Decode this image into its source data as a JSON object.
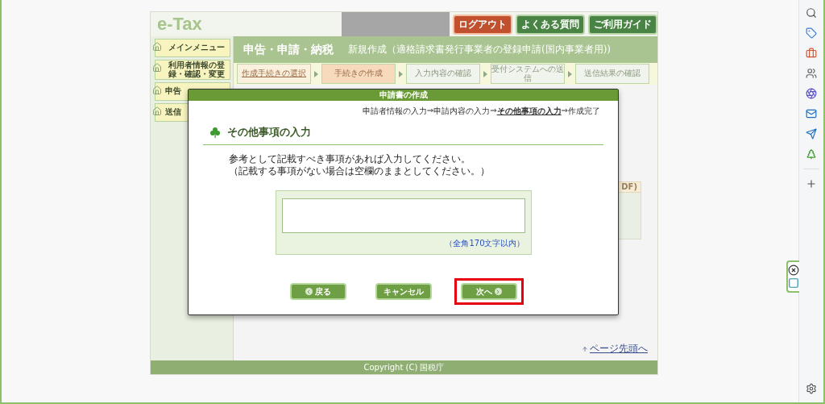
{
  "header": {
    "logo": "e-Tax",
    "buttons": [
      {
        "label": "ログアウト",
        "kind": "logout"
      },
      {
        "label": "よくある質問",
        "kind": "nav"
      },
      {
        "label": "ご利用ガイド",
        "kind": "nav"
      }
    ]
  },
  "sidebar": {
    "items": [
      {
        "label": "メインメニュー"
      },
      {
        "label": "利用者情報の登録・確認・変更"
      },
      {
        "label": "申告"
      },
      {
        "label": "送信"
      }
    ]
  },
  "page": {
    "title": "申告・申請・納税",
    "subtitle": "新規作成（適格請求書発行事業者の登録申請(国内事業者用))",
    "steps": [
      {
        "label": "作成手続きの選択",
        "selected": false,
        "linked": true
      },
      {
        "label": "手続きの作成",
        "selected": true,
        "linked": false
      },
      {
        "label": "入力内容の確認",
        "selected": false,
        "linked": false
      },
      {
        "label": "受付システムへの送信",
        "selected": false,
        "linked": false
      },
      {
        "label": "送信結果の確認",
        "selected": false,
        "linked": false
      }
    ],
    "panel_header": "DF)",
    "top_link": "ページ先頭へ",
    "footer": "Copyright (C) 国税庁"
  },
  "dialog": {
    "title": "申請書の作成",
    "breadcrumb": [
      {
        "label": "申請者情報の入力",
        "selected": false
      },
      {
        "label": "申請内容の入力",
        "selected": false
      },
      {
        "label": "その他事項の入力",
        "selected": true
      },
      {
        "label": "作成完了",
        "selected": false
      }
    ],
    "breadcrumb_separator": "⇒",
    "heading": "その他事項の入力",
    "instructions": [
      "参考として記載すべき事項があれば入力してください。",
      "（記載する事項がない場合は空欄のままとしてください。）"
    ],
    "field": {
      "hint": "（全角170文字以内）"
    },
    "buttons": [
      {
        "label": "戻る",
        "kind": "back",
        "highlighted": false
      },
      {
        "label": "キャンセル",
        "kind": "plain",
        "highlighted": false
      },
      {
        "label": "次へ",
        "kind": "next",
        "highlighted": true
      }
    ]
  }
}
